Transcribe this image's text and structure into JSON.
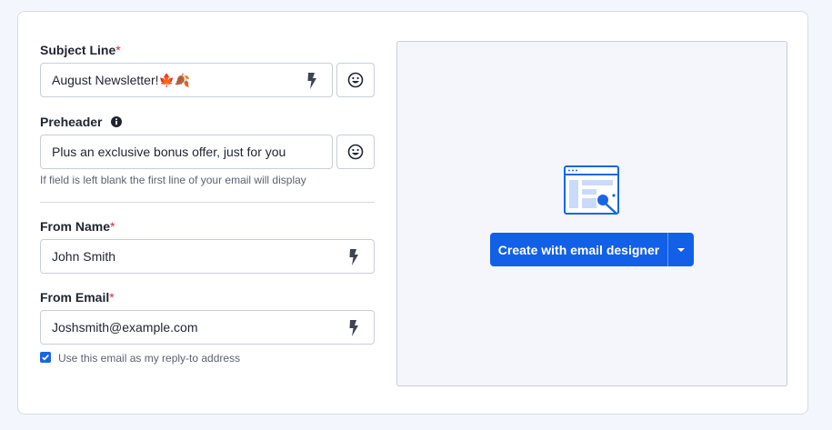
{
  "subject": {
    "label": "Subject Line",
    "required_mark": "*",
    "value": "August Newsletter!🍁🍂",
    "merge_icon": "bolt-icon",
    "emoji_icon": "smiley-icon"
  },
  "preheader": {
    "label": "Preheader",
    "info_icon": "info-icon",
    "value": "Plus an exclusive bonus offer, just for you",
    "emoji_icon": "smiley-icon",
    "hint": "If field is left blank the first line of your email will display"
  },
  "from_name": {
    "label": "From Name",
    "required_mark": "*",
    "value": "John Smith",
    "merge_icon": "bolt-icon"
  },
  "from_email": {
    "label": "From Email",
    "required_mark": "*",
    "value": "Joshsmith@example.com",
    "merge_icon": "bolt-icon",
    "reply_to_checked": true,
    "reply_to_label": "Use this email as my reply-to address"
  },
  "designer": {
    "illustration_icon": "email-designer-icon",
    "button_label": "Create with email designer",
    "caret_icon": "caret-down-icon"
  },
  "colors": {
    "primary": "#1260e8",
    "required": "#d6263f",
    "border": "#c9ced8"
  }
}
